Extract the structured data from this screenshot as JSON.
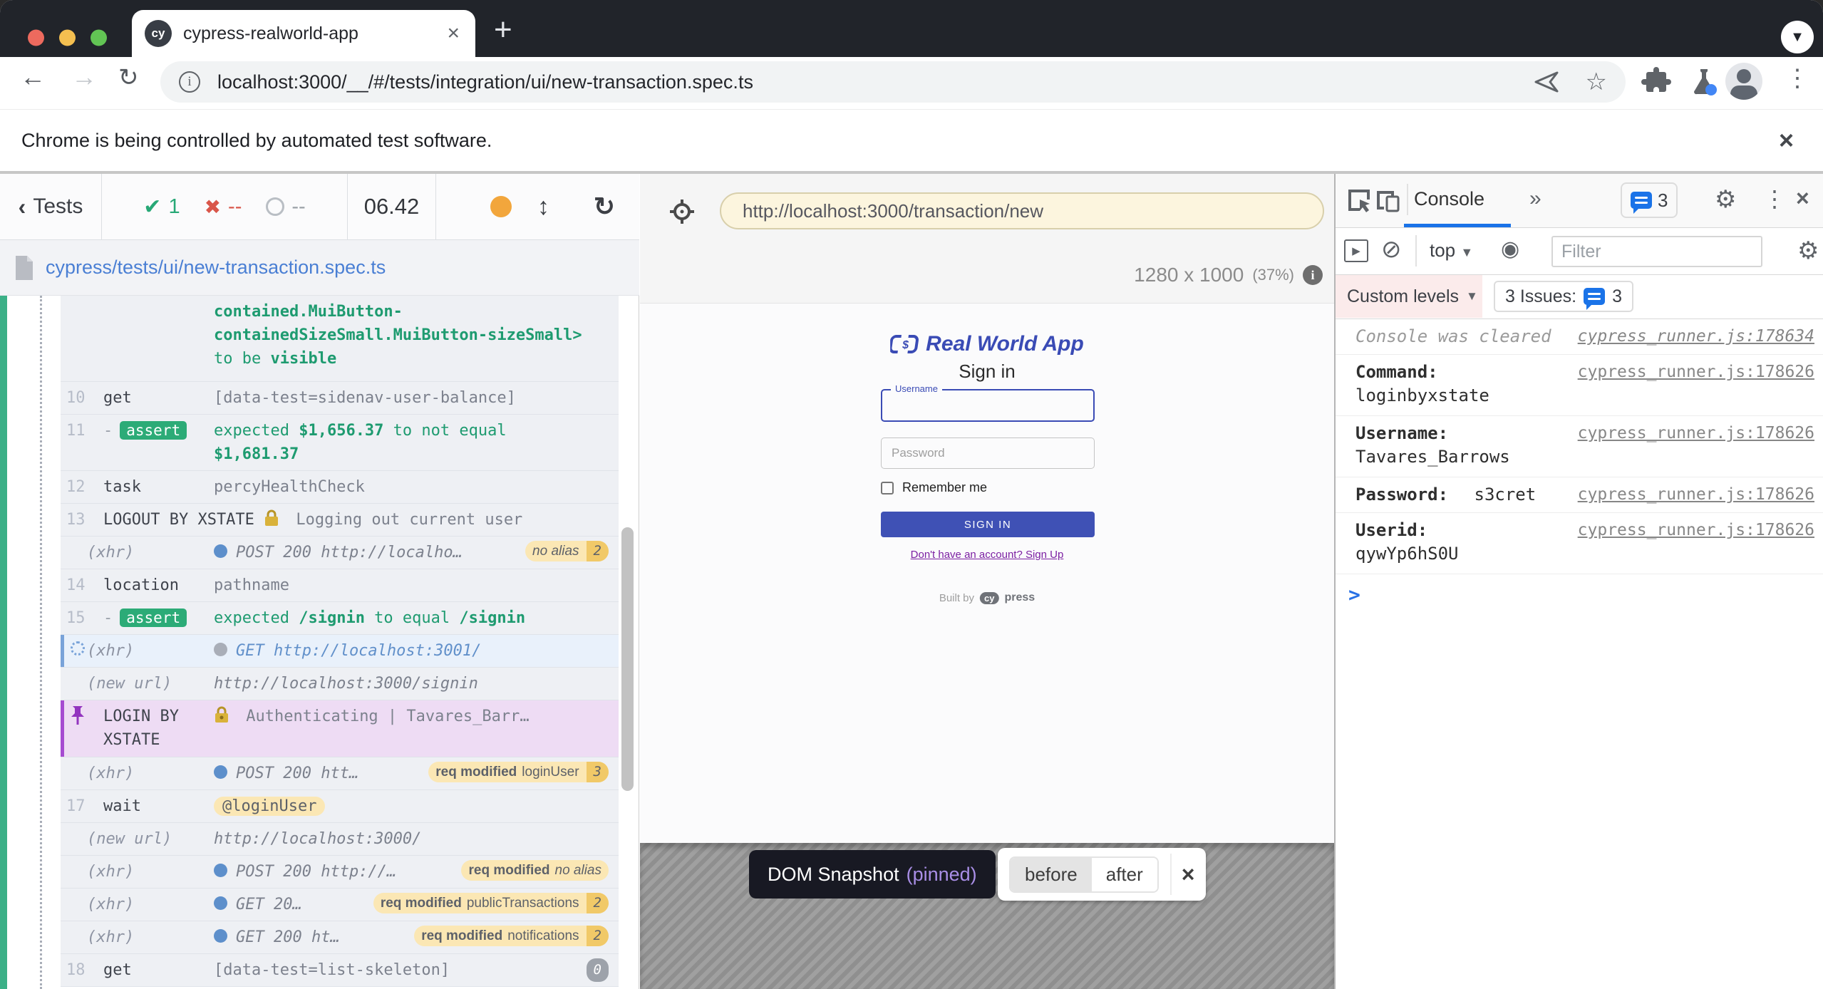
{
  "browser": {
    "tab_title": "cypress-realworld-app",
    "url": "localhost:3000/__/#/tests/integration/ui/new-transaction.spec.ts",
    "banner": "Chrome is being controlled by automated test software.",
    "new_tab": "+",
    "close_glyph": "×",
    "back_glyph": "←",
    "forward_glyph": "→",
    "reload_glyph": "↻",
    "star_glyph": "☆",
    "kebab_glyph": "⋮",
    "info_glyph": "i",
    "favicon_text": "cy",
    "profile_caret": "▼"
  },
  "reporter": {
    "back_chevron": "‹",
    "back_label": "Tests",
    "passed_glyph": "✔",
    "passed": "1",
    "failed_glyph": "✖",
    "failed": "--",
    "pending": "--",
    "time": "06.42",
    "updown_glyph": "↕",
    "refresh_glyph": "↻",
    "spec_path": "cypress/tests/ui/new-transaction.spec.ts",
    "rows": [
      {
        "line1": "contained.MuiButton-",
        "line2": "containedSizeSmall.MuiButton-sizeSmall>",
        "tail_pre": "to be ",
        "tail_bold": "visible"
      },
      {
        "num": "10",
        "method": "get",
        "msg": "[data-test=sidenav-user-balance]"
      },
      {
        "num": "11",
        "dash": "-",
        "badge": "assert",
        "pre": "expected ",
        "b1": "$1,656.37",
        "mid": " to not equal ",
        "b2": "$1,681.37"
      },
      {
        "num": "12",
        "method": "task",
        "msg": "percyHealthCheck"
      },
      {
        "num": "13",
        "method": "LOGOUT BY XSTATE",
        "msg": "Logging out current user"
      },
      {
        "label": "(xhr)",
        "msg": "POST 200 http://localho…",
        "pill_name_italic": "no alias",
        "count": "2"
      },
      {
        "num": "14",
        "method": "location",
        "msg": "pathname"
      },
      {
        "num": "15",
        "dash": "-",
        "badge": "assert",
        "pre": "expected ",
        "b1": "/signin",
        "mid": " to equal ",
        "b2": "/signin"
      },
      {
        "label": "(xhr)",
        "msg": "GET http://localhost:3001/"
      },
      {
        "label": "(new url)",
        "msg": "http://localhost:3000/signin"
      },
      {
        "method": "LOGIN BY XSTATE",
        "msg": "Authenticating | Tavares_Barr…"
      },
      {
        "label": "(xhr)",
        "msg": "POST 200 htt…",
        "pill_bold": "req modified",
        "pill_name": "loginUser",
        "count": "3"
      },
      {
        "num": "17",
        "method": "wait",
        "alias": "@loginUser"
      },
      {
        "label": "(new url)",
        "msg": "http://localhost:3000/"
      },
      {
        "label": "(xhr)",
        "msg": "POST 200 http://…",
        "pill_bold": "req modified",
        "pill_name_italic": "no alias"
      },
      {
        "label": "(xhr)",
        "msg": "GET 20…",
        "pill_bold": "req modified",
        "pill_name": "publicTransactions",
        "count": "2"
      },
      {
        "label": "(xhr)",
        "msg": "GET 200 ht…",
        "pill_bold": "req modified",
        "pill_name": "notifications",
        "count": "2"
      },
      {
        "num": "18",
        "method": "get",
        "msg": "[data-test=list-skeleton]",
        "gray_count": "0"
      }
    ]
  },
  "center": {
    "app_url": "http://localhost:3000/transaction/new",
    "viewport_size": "1280 x 1000",
    "viewport_scale": "(37%)",
    "info_glyph": "i"
  },
  "app": {
    "brand": "Real World App",
    "title": "Sign in",
    "username_label": "Username",
    "password_placeholder": "Password",
    "remember_label": "Remember me",
    "signin_button": "SIGN IN",
    "signup_link": "Don't have an account? Sign Up",
    "built_by": "Built by",
    "wordmark_cy": "cy",
    "wordmark_press": "press"
  },
  "snapshot": {
    "label": "DOM Snapshot",
    "pinned": "(pinned)",
    "before": "before",
    "after": "after",
    "close_glyph": "×"
  },
  "devtools": {
    "tab": "Console",
    "more_glyph": "»",
    "badge_count": "3",
    "play_glyph": "▶",
    "clear_glyph": "⊘",
    "context": "top",
    "caret_glyph": "▼",
    "eye_glyph": "◉",
    "gear_glyph": "⚙",
    "kebab_glyph": "⋮",
    "close_glyph": "×",
    "filter_placeholder": "Filter",
    "custom_levels": "Custom levels",
    "issues_label": "3 Issues:",
    "issues_count": "3",
    "messages": [
      {
        "text": "Console was cleared",
        "source": "cypress_runner.js:178634"
      },
      {
        "label": "Command:",
        "value": "loginbyxstate",
        "source": "cypress_runner.js:178626"
      },
      {
        "label": "Username:",
        "value": "Tavares_Barrows",
        "source": "cypress_runner.js:178626"
      },
      {
        "label": "Password:",
        "value": "s3cret",
        "source": "cypress_runner.js:178626"
      },
      {
        "label": "Userid:",
        "value": "qywYp6hS0U",
        "source": "cypress_runner.js:178626"
      }
    ],
    "prompt_glyph": ">"
  }
}
